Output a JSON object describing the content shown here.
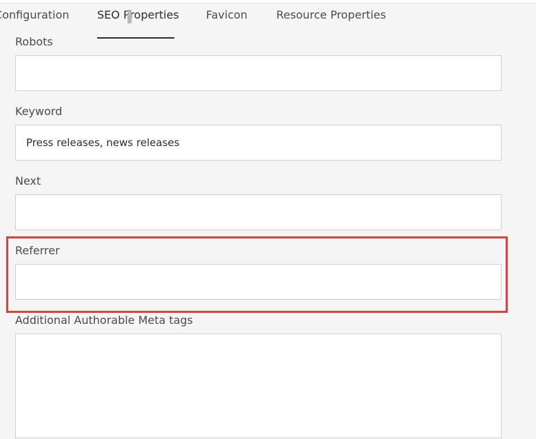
{
  "tabs": {
    "configuration": "Configuration",
    "seo_properties": "SEO Properties",
    "favicon": "Favicon",
    "resource_properties": "Resource Properties"
  },
  "form": {
    "robots": {
      "label": "Robots",
      "value": ""
    },
    "keyword": {
      "label": "Keyword",
      "value": "Press releases, news releases"
    },
    "next": {
      "label": "Next",
      "value": ""
    },
    "referrer": {
      "label": "Referrer",
      "value": ""
    },
    "meta_tags": {
      "label": "Additional Authorable Meta tags",
      "value": ""
    }
  },
  "colors": {
    "background": "#f5f5f5",
    "field_border": "#cfcfcf",
    "highlight": "#e0403a",
    "active_tab": "#2c2c2c"
  }
}
